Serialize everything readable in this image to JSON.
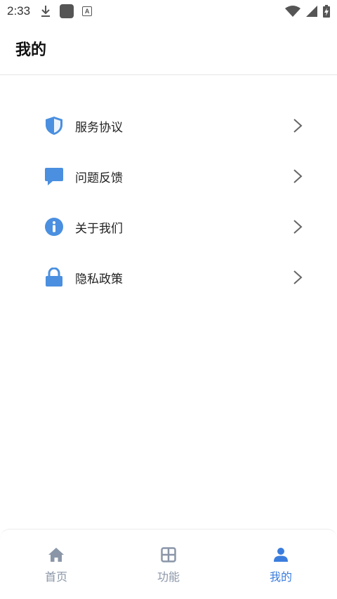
{
  "status_bar": {
    "time": "2:33",
    "letter_badge": "A",
    "icons": [
      "download-icon",
      "app-square-icon",
      "letter-a-icon",
      "wifi-icon",
      "signal-icon",
      "battery-charging-icon"
    ]
  },
  "header": {
    "title": "我的"
  },
  "menu": {
    "items": [
      {
        "label": "服务协议",
        "icon": "shield-icon"
      },
      {
        "label": "问题反馈",
        "icon": "chat-bubble-icon"
      },
      {
        "label": "关于我们",
        "icon": "info-icon"
      },
      {
        "label": "隐私政策",
        "icon": "lock-icon"
      }
    ]
  },
  "bottom_nav": {
    "items": [
      {
        "label": "首页",
        "icon": "home-icon",
        "active": false
      },
      {
        "label": "功能",
        "icon": "grid-icon",
        "active": false
      },
      {
        "label": "我的",
        "icon": "person-icon",
        "active": true
      }
    ]
  },
  "colors": {
    "accent": "#3b7ddd",
    "icon_blue": "#4a8fe0",
    "nav_inactive": "#8a96a8",
    "chevron": "#666666"
  }
}
